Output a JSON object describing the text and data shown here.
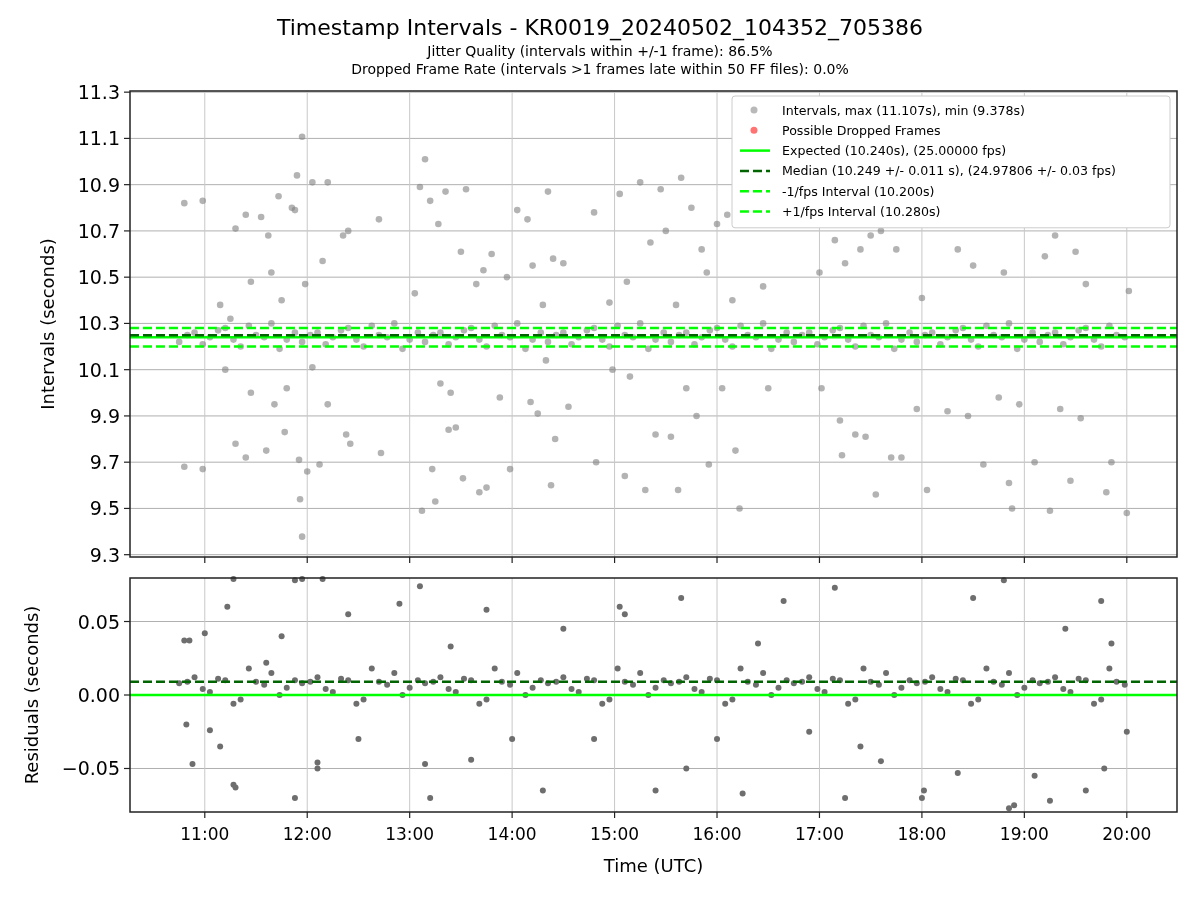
{
  "title": "Timestamp Intervals - KR0019_20240502_104352_705386",
  "subtitles": [
    "Jitter Quality (intervals within +/-1 frame): 86.5%",
    "Dropped Frame Rate (intervals >1 frames late within 50 FF files): 0.0%"
  ],
  "charts": [
    {
      "chart_data": {
        "type": "scatter",
        "ylabel": "Intervals (seconds)",
        "xlim": [
          10.27,
          20.49
        ],
        "ylim": [
          9.29,
          11.305
        ],
        "grid": true,
        "legend": "upper right",
        "yticks": [
          {
            "value": 9.3,
            "label": "9.3"
          },
          {
            "value": 9.5,
            "label": "9.5"
          },
          {
            "value": 9.7,
            "label": "9.7"
          },
          {
            "value": 9.9,
            "label": "9.9"
          },
          {
            "value": 10.1,
            "label": "10.1"
          },
          {
            "value": 10.3,
            "label": "10.3"
          },
          {
            "value": 10.5,
            "label": "10.5"
          },
          {
            "value": 10.7,
            "label": "10.7"
          },
          {
            "value": 10.9,
            "label": "10.9"
          },
          {
            "value": 11.1,
            "label": "11.1"
          },
          {
            "value": 11.3,
            "label": "11.3"
          }
        ],
        "series": [
          {
            "name": "Intervals, max (11.107s), min (9.378s)",
            "color": "#808080",
            "x": [
              10.8,
              10.98,
              10.8,
              10.98,
              11.15,
              11.2,
              11.25,
              11.3,
              11.3,
              11.4,
              11.4,
              11.45,
              11.45,
              11.55,
              11.6,
              11.62,
              11.65,
              11.68,
              11.72,
              11.75,
              11.78,
              11.8,
              11.85,
              11.88,
              11.9,
              11.92,
              11.93,
              11.95,
              11.95,
              11.98,
              12.0,
              12.05,
              12.05,
              12.12,
              12.15,
              12.2,
              12.2,
              12.35,
              12.38,
              12.4,
              12.42,
              12.7,
              12.72,
              13.05,
              13.1,
              13.12,
              13.15,
              13.2,
              13.22,
              13.25,
              13.28,
              13.3,
              13.35,
              13.38,
              13.4,
              13.45,
              13.5,
              13.52,
              13.55,
              13.65,
              13.68,
              13.72,
              13.75,
              13.8,
              13.88,
              13.95,
              13.98,
              14.05,
              14.15,
              14.18,
              14.2,
              14.25,
              14.3,
              14.33,
              14.35,
              14.38,
              14.4,
              14.42,
              14.5,
              14.55,
              14.8,
              14.82,
              14.95,
              14.98,
              15.05,
              15.1,
              15.12,
              15.15,
              15.25,
              15.3,
              15.35,
              15.4,
              15.45,
              15.5,
              15.55,
              15.6,
              15.62,
              15.65,
              15.7,
              15.75,
              15.8,
              15.85,
              15.9,
              15.92,
              16.0,
              16.05,
              16.1,
              16.15,
              16.18,
              16.22,
              16.45,
              16.5,
              17.0,
              17.02,
              17.15,
              17.2,
              17.22,
              17.25,
              17.35,
              17.4,
              17.45,
              17.5,
              17.55,
              17.6,
              17.7,
              17.75,
              17.8,
              17.95,
              18.0,
              18.05,
              18.25,
              18.35,
              18.45,
              18.5,
              18.6,
              18.75,
              18.8,
              18.85,
              18.88,
              18.95,
              19.1,
              19.2,
              19.25,
              19.3,
              19.35,
              19.45,
              19.5,
              19.55,
              19.6,
              19.8,
              19.85,
              20.0,
              20.02,
              10.75,
              10.9,
              11.05,
              11.2,
              11.35,
              11.5,
              11.65,
              11.8,
              11.95,
              12.1,
              12.25,
              12.4,
              12.55,
              12.7,
              12.85,
              13.0,
              13.15,
              13.3,
              13.45,
              13.6,
              13.75,
              13.9,
              14.05,
              14.2,
              14.35,
              14.5,
              14.65,
              14.8,
              14.95,
              15.1,
              15.25,
              15.4,
              15.55,
              15.7,
              15.85,
              16.0,
              16.15,
              16.3,
              16.45,
              16.6,
              16.75,
              16.9,
              17.05,
              17.2,
              17.35,
              17.5,
              17.65,
              17.8,
              17.95,
              18.1,
              18.25,
              18.4,
              18.55,
              18.7,
              18.85,
              19.0,
              19.15,
              19.3,
              19.45,
              19.6,
              19.75,
              19.9,
              10.83,
              10.98,
              11.13,
              11.28,
              11.43,
              11.58,
              11.73,
              11.88,
              12.03,
              12.18,
              12.33,
              12.48,
              12.63,
              12.78,
              12.93,
              13.08,
              13.23,
              13.38,
              13.53,
              13.68,
              13.83,
              13.98,
              14.13,
              14.28,
              14.43,
              14.58,
              14.73,
              14.88,
              15.03,
              15.18,
              15.33,
              15.48,
              15.63,
              15.78,
              15.93,
              16.08,
              16.23,
              16.38,
              16.53,
              16.68,
              16.83,
              16.98,
              17.13,
              17.28,
              17.43,
              17.58,
              17.73,
              17.88,
              18.03,
              18.18,
              18.33,
              18.48,
              18.63,
              18.78,
              18.93,
              19.08,
              19.23,
              19.38,
              19.53,
              19.68,
              19.83,
              19.98
            ],
            "values": [
              10.82,
              10.83,
              9.68,
              9.67,
              10.38,
              10.1,
              10.32,
              10.71,
              9.78,
              10.77,
              9.72,
              10.48,
              10.0,
              10.76,
              9.75,
              10.68,
              10.52,
              9.95,
              10.85,
              10.4,
              9.83,
              10.02,
              10.8,
              10.79,
              10.94,
              9.71,
              9.54,
              11.107,
              9.378,
              10.47,
              9.66,
              10.91,
              10.11,
              9.69,
              10.57,
              10.91,
              9.95,
              10.68,
              9.82,
              10.7,
              9.78,
              10.75,
              9.74,
              10.43,
              10.89,
              9.49,
              11.01,
              10.83,
              9.67,
              9.53,
              10.73,
              10.04,
              10.87,
              9.84,
              10.0,
              9.85,
              10.61,
              9.63,
              10.88,
              10.47,
              9.57,
              10.53,
              9.59,
              10.6,
              9.98,
              10.5,
              9.67,
              10.79,
              10.75,
              9.96,
              10.55,
              9.91,
              10.38,
              10.14,
              10.87,
              9.6,
              10.58,
              9.8,
              10.56,
              9.94,
              10.78,
              9.7,
              10.39,
              10.1,
              10.86,
              9.64,
              10.48,
              10.07,
              10.91,
              9.58,
              10.65,
              9.82,
              10.88,
              10.7,
              9.81,
              10.38,
              9.58,
              10.93,
              10.02,
              10.8,
              9.9,
              10.62,
              10.52,
              9.69,
              10.73,
              10.02,
              10.77,
              10.4,
              9.75,
              9.5,
              10.46,
              10.02,
              10.52,
              10.02,
              10.66,
              9.88,
              9.73,
              10.56,
              9.82,
              10.62,
              9.81,
              10.68,
              9.56,
              10.7,
              9.72,
              10.62,
              9.72,
              9.93,
              10.41,
              9.58,
              9.92,
              10.62,
              9.9,
              10.55,
              9.69,
              9.98,
              10.52,
              9.61,
              9.5,
              9.95,
              9.7,
              10.59,
              9.49,
              10.68,
              9.93,
              9.62,
              10.61,
              9.89,
              10.47,
              9.57,
              9.7,
              9.48,
              10.44,
              10.22,
              10.26,
              10.24,
              10.28,
              10.2,
              10.25,
              10.3,
              10.23,
              10.22,
              10.26,
              10.24,
              10.28,
              10.2,
              10.25,
              10.3,
              10.23,
              10.22,
              10.26,
              10.24,
              10.28,
              10.2,
              10.25,
              10.3,
              10.23,
              10.22,
              10.26,
              10.24,
              10.28,
              10.2,
              10.25,
              10.3,
              10.23,
              10.22,
              10.26,
              10.24,
              10.28,
              10.2,
              10.25,
              10.3,
              10.23,
              10.22,
              10.26,
              10.24,
              10.28,
              10.2,
              10.25,
              10.3,
              10.23,
              10.22,
              10.26,
              10.24,
              10.28,
              10.2,
              10.25,
              10.3,
              10.23,
              10.22,
              10.26,
              10.24,
              10.28,
              10.2,
              10.25,
              10.25,
              10.21,
              10.27,
              10.23,
              10.29,
              10.24,
              10.19,
              10.26,
              10.25,
              10.21,
              10.27,
              10.23,
              10.29,
              10.24,
              10.19,
              10.26,
              10.25,
              10.21,
              10.27,
              10.23,
              10.29,
              10.24,
              10.19,
              10.26,
              10.25,
              10.21,
              10.27,
              10.23,
              10.29,
              10.24,
              10.19,
              10.26,
              10.25,
              10.21,
              10.27,
              10.23,
              10.29,
              10.24,
              10.19,
              10.26,
              10.25,
              10.21,
              10.27,
              10.23,
              10.29,
              10.24,
              10.19,
              10.26,
              10.25,
              10.21,
              10.27,
              10.23,
              10.29,
              10.24,
              10.19,
              10.26,
              10.25,
              10.21,
              10.27,
              10.23,
              10.29,
              10.24
            ]
          },
          {
            "name": "Possible Dropped Frames",
            "color": "#ff0000"
          }
        ],
        "ref_lines": [
          {
            "axis": "y",
            "value": 10.24,
            "label": "Expected (10.240s), (25.00000 fps)",
            "color": "#00ff00"
          },
          {
            "axis": "y",
            "value": 10.249,
            "label": "Median (10.249 +/- 0.011 s), (24.97806 +/- 0.03 fps)",
            "color": "#006400"
          },
          {
            "axis": "y",
            "value": 10.2,
            "label": "-1/fps Interval (10.200s)",
            "color": "#00ff00"
          },
          {
            "axis": "y",
            "value": 10.28,
            "label": "+1/fps Interval (10.280s)",
            "color": "#00ff00"
          }
        ]
      }
    },
    {
      "chart_data": {
        "type": "scatter",
        "grid": true,
        "xlabel": "Time (UTC)",
        "ylabel": "Residuals (seconds)",
        "xlim": [
          10.27,
          20.49
        ],
        "ylim": [
          -0.0796,
          0.0796
        ],
        "xticks": [
          {
            "value": 11,
            "label": "11:00"
          },
          {
            "value": 12,
            "label": "12:00"
          },
          {
            "value": 13,
            "label": "13:00"
          },
          {
            "value": 14,
            "label": "14:00"
          },
          {
            "value": 15,
            "label": "15:00"
          },
          {
            "value": 16,
            "label": "16:00"
          },
          {
            "value": 17,
            "label": "17:00"
          },
          {
            "value": 18,
            "label": "18:00"
          },
          {
            "value": 19,
            "label": "19:00"
          },
          {
            "value": 20,
            "label": "20:00"
          }
        ],
        "yticks": [
          {
            "value": 0.05,
            "label": "0.05"
          },
          {
            "value": 0,
            "label": "0.00"
          },
          {
            "value": -0.05,
            "label": "−0.05"
          }
        ],
        "series": [
          {
            "color": "#6e6e6e",
            "x": [
              10.8,
              10.85,
              10.82,
              10.88,
              11.0,
              11.05,
              11.15,
              11.22,
              11.28,
              11.3,
              11.28,
              11.6,
              11.75,
              11.88,
              11.88,
              11.95,
              12.1,
              12.1,
              12.15,
              12.4,
              12.5,
              12.9,
              13.1,
              13.15,
              13.2,
              13.4,
              13.6,
              13.75,
              14.0,
              14.3,
              14.5,
              14.8,
              15.05,
              15.1,
              15.4,
              15.65,
              15.7,
              16.0,
              16.25,
              16.4,
              16.65,
              16.9,
              17.15,
              17.25,
              17.4,
              17.6,
              18.0,
              18.02,
              18.35,
              18.5,
              18.8,
              18.85,
              18.9,
              19.1,
              19.25,
              19.4,
              19.6,
              19.75,
              19.78,
              19.85,
              20.0,
              10.75,
              10.9,
              11.05,
              11.2,
              11.35,
              11.5,
              11.65,
              11.8,
              11.95,
              12.1,
              12.25,
              12.4,
              12.55,
              12.7,
              12.85,
              13.0,
              13.15,
              13.3,
              13.45,
              13.6,
              13.75,
              13.9,
              14.05,
              14.2,
              14.35,
              14.5,
              14.65,
              14.8,
              14.95,
              15.1,
              15.25,
              15.4,
              15.55,
              15.7,
              15.85,
              16.0,
              16.15,
              16.3,
              16.45,
              16.6,
              16.75,
              16.9,
              17.05,
              17.2,
              17.35,
              17.5,
              17.65,
              17.8,
              17.95,
              18.1,
              18.25,
              18.4,
              18.55,
              18.7,
              18.85,
              19.0,
              19.15,
              19.3,
              19.45,
              19.6,
              19.75,
              19.9,
              10.83,
              10.98,
              11.13,
              11.28,
              11.43,
              11.58,
              11.73,
              11.88,
              12.03,
              12.18,
              12.33,
              12.48,
              12.63,
              12.78,
              12.93,
              13.08,
              13.23,
              13.38,
              13.53,
              13.68,
              13.83,
              13.98,
              14.13,
              14.28,
              14.43,
              14.58,
              14.73,
              14.88,
              15.03,
              15.18,
              15.33,
              15.48,
              15.63,
              15.78,
              15.93,
              16.08,
              16.23,
              16.38,
              16.53,
              16.68,
              16.83,
              16.98,
              17.13,
              17.28,
              17.43,
              17.58,
              17.73,
              17.88,
              18.03,
              18.18,
              18.33,
              18.48,
              18.63,
              18.78,
              18.93,
              19.08,
              19.23,
              19.38,
              19.53,
              19.68,
              19.83,
              19.98
            ],
            "values": [
              0.037,
              0.037,
              -0.02,
              -0.047,
              0.042,
              -0.024,
              -0.035,
              0.06,
              -0.061,
              -0.063,
              0.079,
              0.022,
              0.04,
              0.078,
              -0.07,
              0.079,
              -0.046,
              -0.05,
              0.079,
              0.055,
              -0.03,
              0.062,
              0.074,
              -0.047,
              -0.07,
              0.033,
              -0.044,
              0.058,
              -0.03,
              -0.065,
              0.045,
              -0.03,
              0.06,
              0.055,
              -0.065,
              0.066,
              -0.05,
              -0.03,
              -0.067,
              0.035,
              0.064,
              -0.025,
              0.073,
              -0.07,
              -0.035,
              -0.045,
              -0.07,
              -0.065,
              -0.053,
              0.066,
              0.078,
              -0.077,
              -0.075,
              -0.055,
              -0.072,
              0.045,
              -0.065,
              0.064,
              -0.05,
              0.035,
              -0.025,
              0.008,
              0.012,
              0.002,
              0.01,
              -0.003,
              0.009,
              0.015,
              0.005,
              0.008,
              0.012,
              0.002,
              0.01,
              -0.003,
              0.009,
              0.015,
              0.005,
              0.008,
              0.012,
              0.002,
              0.01,
              -0.003,
              0.009,
              0.015,
              0.005,
              0.008,
              0.012,
              0.002,
              0.01,
              -0.003,
              0.009,
              0.015,
              0.005,
              0.008,
              0.012,
              0.002,
              0.01,
              -0.003,
              0.009,
              0.015,
              0.005,
              0.008,
              0.012,
              0.002,
              0.01,
              -0.003,
              0.009,
              0.015,
              0.005,
              0.008,
              0.012,
              0.002,
              0.01,
              -0.003,
              0.009,
              0.015,
              0.005,
              0.008,
              0.012,
              0.002,
              0.01,
              -0.003,
              0.009,
              0.009,
              0.004,
              0.011,
              -0.006,
              0.018,
              0.007,
              0.0,
              0.01,
              0.009,
              0.004,
              0.011,
              -0.006,
              0.018,
              0.007,
              0.0,
              0.01,
              0.009,
              0.004,
              0.011,
              -0.006,
              0.018,
              0.007,
              0.0,
              0.01,
              0.009,
              0.004,
              0.011,
              -0.006,
              0.018,
              0.007,
              0.0,
              0.01,
              0.009,
              0.004,
              0.011,
              -0.006,
              0.018,
              0.007,
              0.0,
              0.01,
              0.009,
              0.004,
              0.011,
              -0.006,
              0.018,
              0.007,
              0.0,
              0.01,
              0.009,
              0.004,
              0.011,
              -0.006,
              0.018,
              0.007,
              0.0,
              0.01,
              0.009,
              0.004,
              0.011,
              -0.006,
              0.018,
              0.007
            ]
          }
        ],
        "ref_lines": [
          {
            "axis": "y",
            "value": 0,
            "color": "#00ff00"
          },
          {
            "axis": "y",
            "value": 0.009,
            "color": "#006400"
          }
        ]
      }
    }
  ]
}
